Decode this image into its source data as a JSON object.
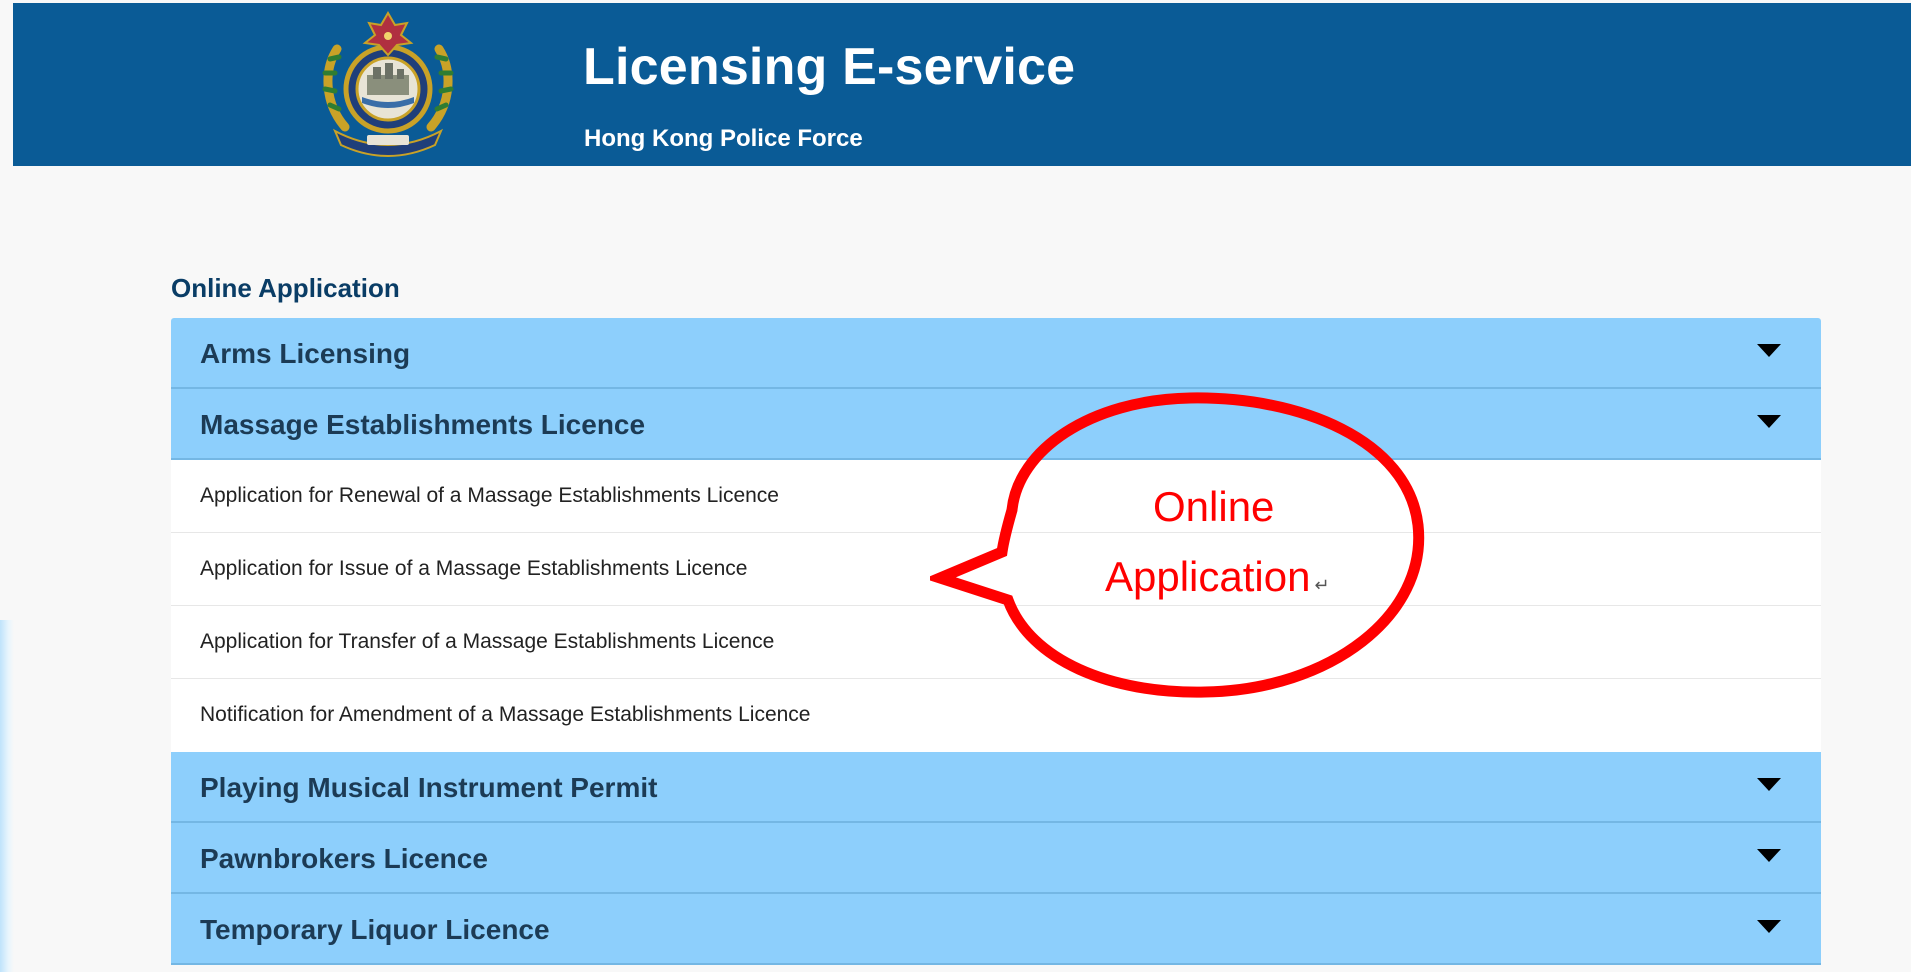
{
  "header": {
    "title": "Licensing E-service",
    "subtitle": "Hong Kong Police Force",
    "logo": "police-crest-icon",
    "background_color": "#0a5b96"
  },
  "section_title": "Online Application",
  "accordion": {
    "header_color": "#8dcffc",
    "sections": [
      {
        "label": "Arms Licensing",
        "expanded": false
      },
      {
        "label": "Massage Establishments Licence",
        "expanded": true,
        "items": [
          "Application for Renewal of a Massage Establishments Licence",
          "Application for Issue of a Massage Establishments Licence",
          "Application for Transfer of a Massage Establishments Licence",
          "Notification for Amendment of a Massage Establishments Licence"
        ]
      },
      {
        "label": "Playing Musical Instrument Permit",
        "expanded": false
      },
      {
        "label": "Pawnbrokers Licence",
        "expanded": false
      },
      {
        "label": "Temporary Liquor Licence",
        "expanded": false
      }
    ]
  },
  "callout": {
    "line1": "Online",
    "line2": "Application",
    "return_mark": "↵",
    "color": "#ff0000"
  }
}
